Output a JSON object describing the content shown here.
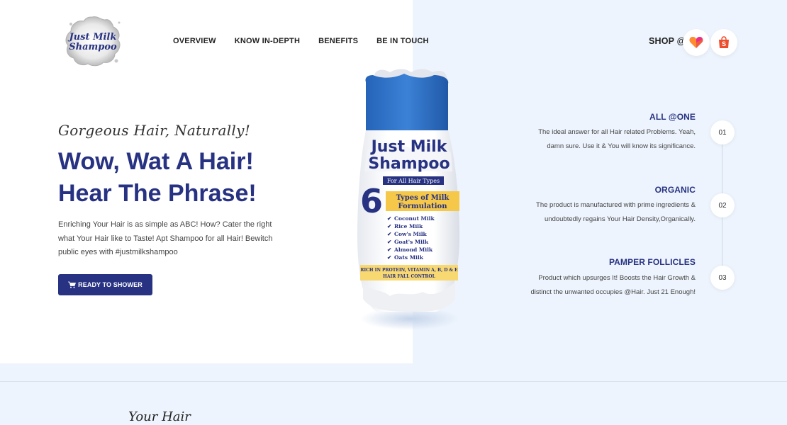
{
  "brand": {
    "logo_line1": "Just Milk",
    "logo_line2": "Shampoo"
  },
  "nav": {
    "items": [
      {
        "label": "OVERVIEW"
      },
      {
        "label": "KNOW IN-DEPTH"
      },
      {
        "label": "BENEFITS"
      },
      {
        "label": "BE IN TOUCH"
      }
    ]
  },
  "shop": {
    "label": "SHOP @",
    "stores": [
      {
        "icon": "lazada-heart-icon"
      },
      {
        "icon": "shopee-bag-icon"
      }
    ]
  },
  "hero": {
    "tagline": "Gorgeous Hair, Naturally!",
    "headline_line1": "Wow, Wat A Hair!",
    "headline_line2": "Hear The Phrase!",
    "description": "Enriching Your Hair is as simple as ABC! How? Cater the right what Your Hair like to Taste! Apt Shampoo for all Hair! Bewitch public eyes with #justmilkshampoo",
    "cta_label": "READY TO SHOWER"
  },
  "product": {
    "name_line1": "Just Milk",
    "name_line2": "Shampoo",
    "hair_types": "For All Hair Types",
    "big_number": "6",
    "formulation_line1": "Types of Milk",
    "formulation_line2": "Formulation",
    "milks": [
      "Coconut Milk",
      "Rice Milk",
      "Cow's Milk",
      "Goat's Milk",
      "Almond Milk",
      "Oats Milk"
    ],
    "footer_line1": "RICH IN PROTEIN, VITAMIN A, B, D & E",
    "footer_line2": "HAIR FALL CONTROL"
  },
  "features": [
    {
      "title": "ALL @ONE",
      "line1": "The ideal answer for all Hair related Problems. Yeah,",
      "line2": "damn sure. Use it & You will know its significance.",
      "number": "01"
    },
    {
      "title": "ORGANIC",
      "line1": "The product is manufactured with prime ingredients &",
      "line2": "undoubtedly regains Your Hair Density,Organically.",
      "number": "02"
    },
    {
      "title": "PAMPER FOLLICLES",
      "line1": "Product which upsurges It! Boosts the Hair Growth &",
      "line2": "distinct the unwanted occupies @Hair. Just 21 Enough!",
      "number": "03"
    }
  ],
  "next_section": {
    "heading": "Your Hair"
  },
  "colors": {
    "accent": "#273282",
    "panel_bg": "#edf4fd",
    "cap_blue": "#2f6fc4",
    "label_yellow": "#f5c84a"
  }
}
